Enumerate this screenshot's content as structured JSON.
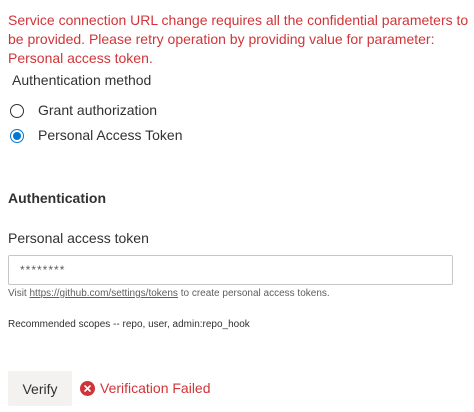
{
  "error": {
    "message": "Service connection URL change requires all the confidential parameters to be provided. Please retry operation by providing value for parameter: Personal access token."
  },
  "auth_method": {
    "label": "Authentication method",
    "options": [
      {
        "label": "Grant authorization",
        "selected": false
      },
      {
        "label": "Personal Access Token",
        "selected": true
      }
    ]
  },
  "authentication": {
    "title": "Authentication",
    "token_label": "Personal access token",
    "token_value": "********",
    "help_prefix": "Visit ",
    "help_link": "https://github.com/settings/tokens",
    "help_suffix": " to create personal access tokens.",
    "scopes": "Recommended scopes -- repo, user, admin:repo_hook"
  },
  "verify": {
    "button_label": "Verify",
    "status_text": "Verification Failed"
  },
  "colors": {
    "error": "#d13438",
    "accent": "#0078d4"
  }
}
